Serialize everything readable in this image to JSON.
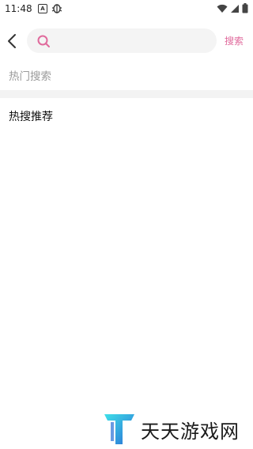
{
  "status_bar": {
    "time": "11:48",
    "icons": [
      "a-badge-icon",
      "bug-icon",
      "wifi-icon",
      "signal-icon",
      "battery-icon"
    ]
  },
  "header": {
    "back_icon": "chevron-left-icon",
    "search": {
      "icon": "search-icon",
      "value": "",
      "placeholder": ""
    },
    "submit_label": "搜索"
  },
  "sections": {
    "hot_search": {
      "heading": "热门搜索"
    },
    "hot_recommend": {
      "heading": "热搜推荐"
    }
  },
  "watermark": {
    "text": "天天游戏网"
  },
  "colors": {
    "accent": "#e06a9c",
    "heading_muted": "#9a9a9a",
    "search_bg": "#f4f4f4",
    "divider": "#f3f3f3"
  }
}
